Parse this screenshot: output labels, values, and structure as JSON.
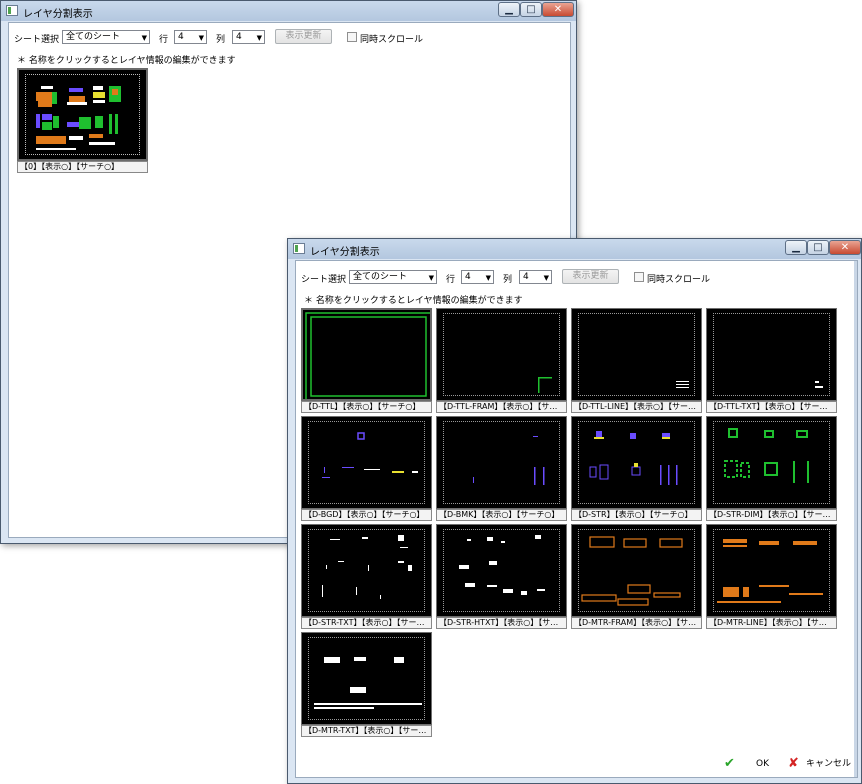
{
  "back_window": {
    "title": "レイヤ分割表示",
    "toolbar": {
      "sheet_label": "シート選択",
      "sheet_value": "全てのシート",
      "row_label": "行",
      "row_value": "4",
      "col_label": "列",
      "col_value": "4",
      "refresh_label": "表示更新",
      "sync_label": "同時スクロール"
    },
    "hint": "＊ 名称をクリックするとレイヤ情報の編集ができます",
    "thumb_caption": "【0】【表示○】【サーチ○】"
  },
  "front_window": {
    "title": "レイヤ分割表示",
    "toolbar": {
      "sheet_label": "シート選択",
      "sheet_value": "全てのシート",
      "row_label": "行",
      "row_value": "4",
      "col_label": "列",
      "col_value": "4",
      "refresh_label": "表示更新",
      "sync_label": "同時スクロール"
    },
    "hint": "＊ 名称をクリックするとレイヤ情報の編集ができます",
    "thumbnails": [
      {
        "caption": "【D-TTL】【表示○】【サーチ○】"
      },
      {
        "caption": "【D-TTL-FRAM】【表示○】【サーチ○】"
      },
      {
        "caption": "【D-TTL-LINE】【表示○】【サーチ○】"
      },
      {
        "caption": "【D-TTL-TXT】【表示○】【サーチ○】"
      },
      {
        "caption": "【D-BGD】【表示○】【サーチ○】"
      },
      {
        "caption": "【D-BMK】【表示○】【サーチ○】"
      },
      {
        "caption": "【D-STR】【表示○】【サーチ○】"
      },
      {
        "caption": "【D-STR-DIM】【表示○】【サーチ○】"
      },
      {
        "caption": "【D-STR-TXT】【表示○】【サーチ○】"
      },
      {
        "caption": "【D-STR-HTXT】【表示○】【サーチ○】"
      },
      {
        "caption": "【D-MTR-FRAM】【表示○】【サーチ○】"
      },
      {
        "caption": "【D-MTR-LINE】【表示○】【サーチ○】"
      },
      {
        "caption": "【D-MTR-TXT】【表示○】【サーチ○】"
      }
    ],
    "ok_label": "OK",
    "cancel_label": "キャンセル"
  },
  "colors": {
    "green": "#1fbf2f",
    "orange": "#e07a1a",
    "purple": "#6a4cff",
    "yellow": "#e8e030",
    "white": "#ffffff"
  }
}
